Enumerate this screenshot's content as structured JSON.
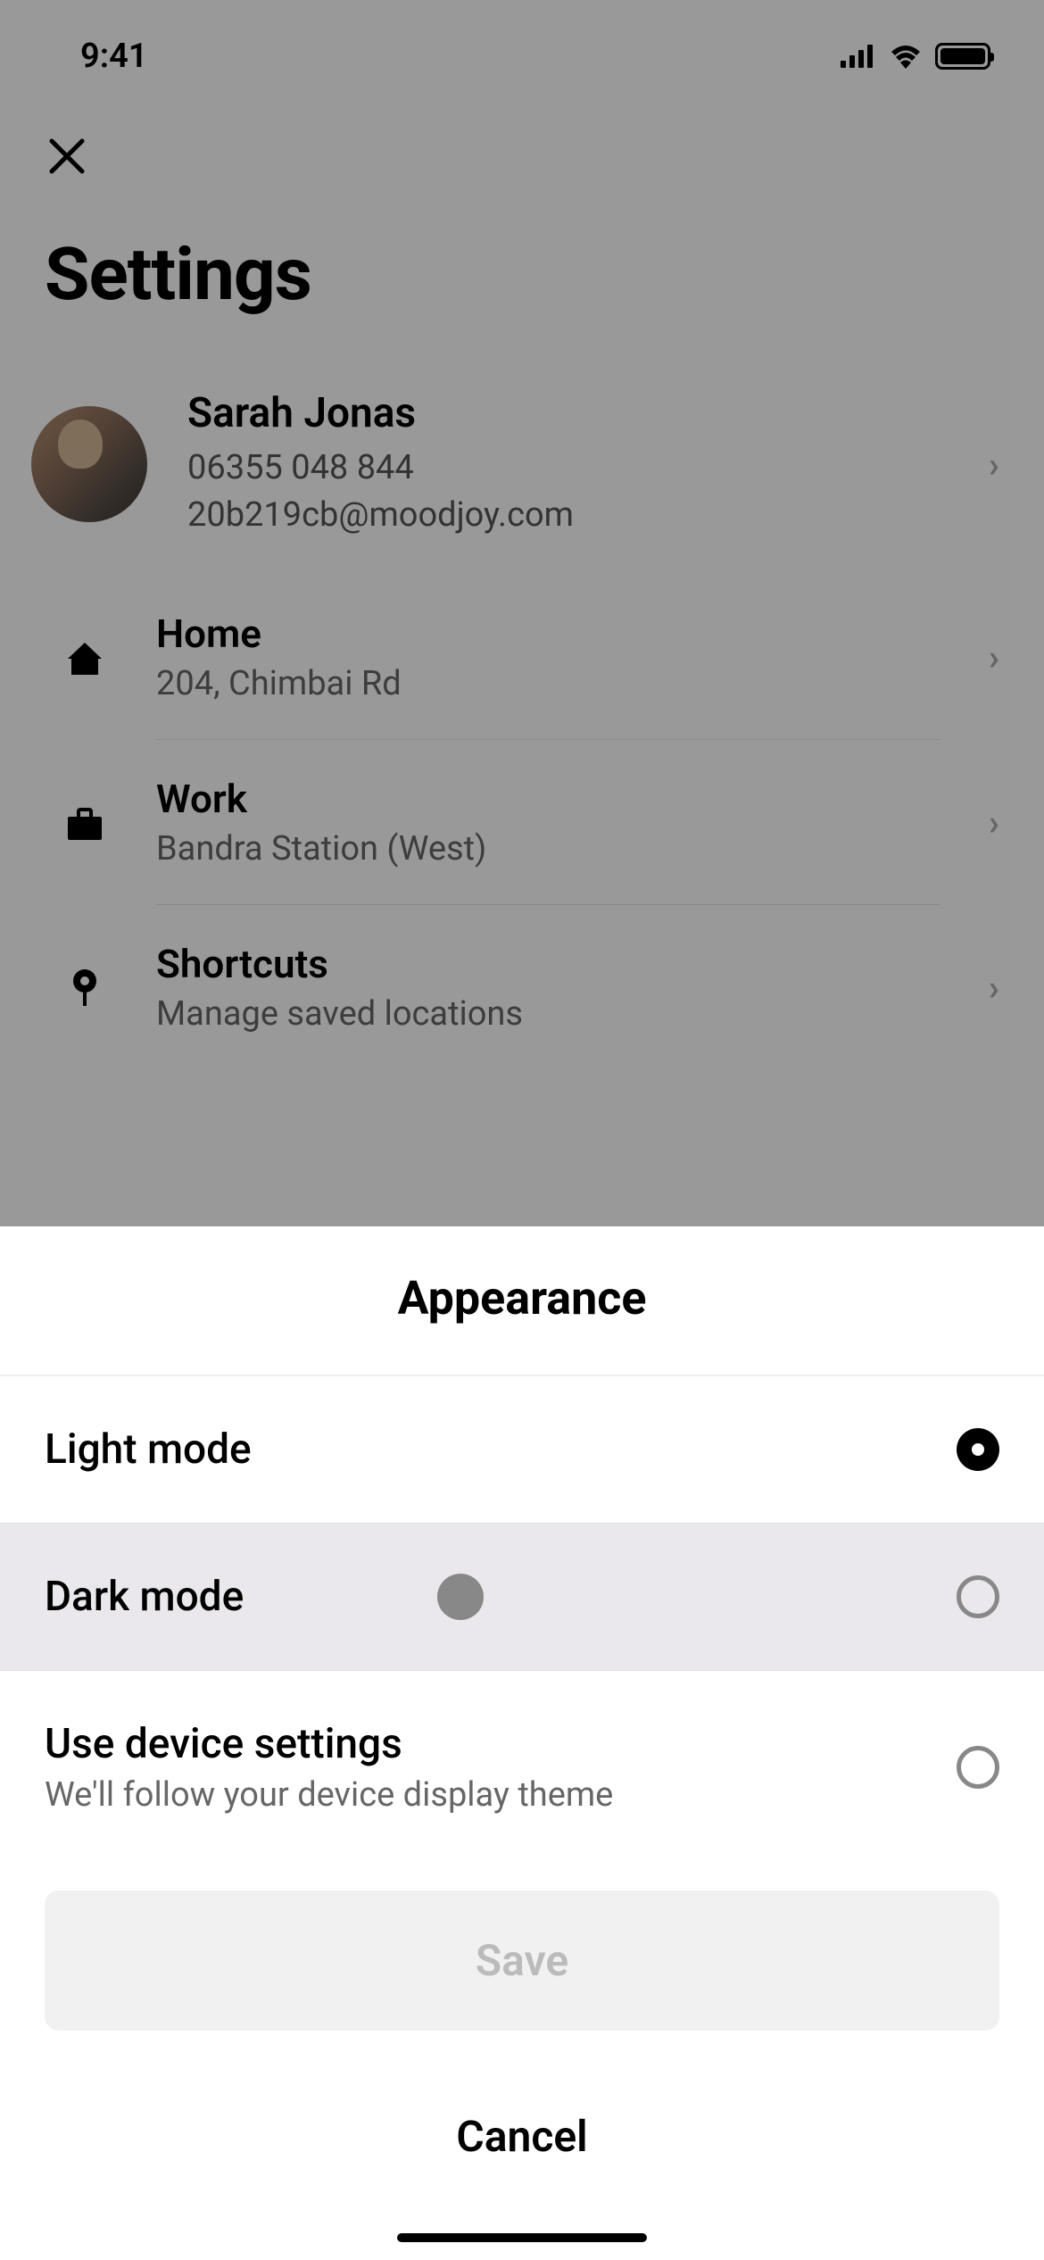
{
  "status": {
    "time": "9:41"
  },
  "header": {
    "title": "Settings"
  },
  "profile": {
    "name": "Sarah Jonas",
    "phone": "06355 048 844",
    "email": "20b219cb@moodjoy.com"
  },
  "locations": [
    {
      "label": "Home",
      "sublabel": "204, Chimbai Rd",
      "icon": "home"
    },
    {
      "label": "Work",
      "sublabel": "Bandra Station (West)",
      "icon": "briefcase"
    },
    {
      "label": "Shortcuts",
      "sublabel": "Manage saved locations",
      "icon": "pin"
    }
  ],
  "sheet": {
    "title": "Appearance",
    "options": [
      {
        "label": "Light mode",
        "sublabel": "",
        "selected": true
      },
      {
        "label": "Dark mode",
        "sublabel": "",
        "selected": false,
        "highlighted": true
      },
      {
        "label": "Use device settings",
        "sublabel": "We'll follow your device display theme",
        "selected": false
      }
    ],
    "save_label": "Save",
    "cancel_label": "Cancel"
  }
}
